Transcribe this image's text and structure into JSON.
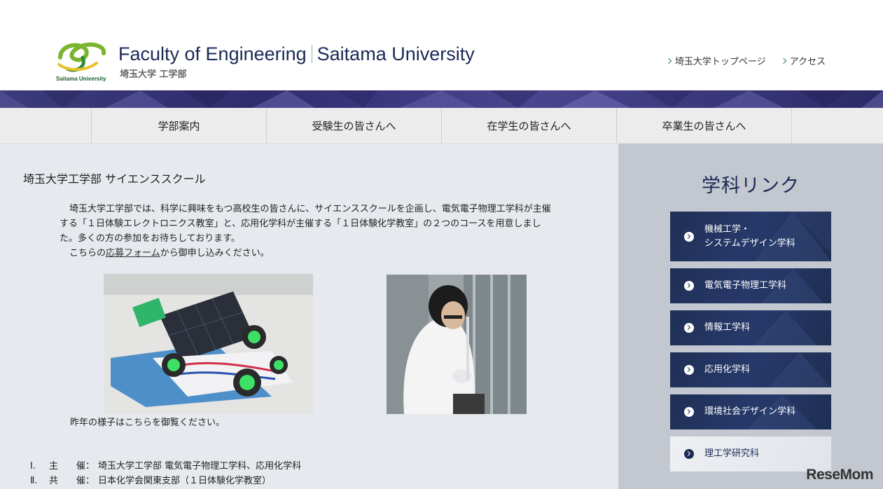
{
  "header": {
    "logo_caption": "Saitama University",
    "title_en_1": "Faculty of Engineering",
    "title_en_2": "Saitama University",
    "title_ja": "埼玉大学 工学部",
    "top_links": [
      "埼玉大学トップページ",
      "アクセス"
    ]
  },
  "nav": {
    "items": [
      "学部案内",
      "受験生の皆さんへ",
      "在学生の皆さんへ",
      "卒業生の皆さんへ"
    ]
  },
  "main": {
    "page_title": "埼玉大学工学部 サイエンススクール",
    "intro_1": "埼玉大学工学部では、科学に興味をもつ高校生の皆さんに、サイエンススクールを企画し、電気電子物理工学科が主催する「１日体験エレクトロニクス教室」と、応用化学科が主催する「１日体験化学教室」の２つのコースを用意しました。多くの方の参加をお待ちしております。",
    "intro_2_pre": "こちらの",
    "intro_2_link": "応募フォーム",
    "intro_2_post": "から御申し込みください。",
    "lastyear_pre": "昨年の様子は",
    "lastyear_link": "こちら",
    "lastyear_post": "を御覧ください。",
    "info": [
      {
        "num": "Ⅰ.",
        "key": "主　　催：",
        "value": "埼玉大学工学部 電気電子物理工学科、応用化学科"
      },
      {
        "num": "Ⅱ.",
        "key": "共　　催：",
        "value": "日本化学会関東支部（１日体験化学教室）"
      }
    ]
  },
  "sidebar": {
    "title": "学科リンク",
    "departments": [
      "機械工学・\nシステムデザイン学科",
      "電気電子物理工学科",
      "情報工学科",
      "応用化学科",
      "環境社会デザイン学科",
      "理工学研究科"
    ]
  },
  "watermark": "ReseMom"
}
